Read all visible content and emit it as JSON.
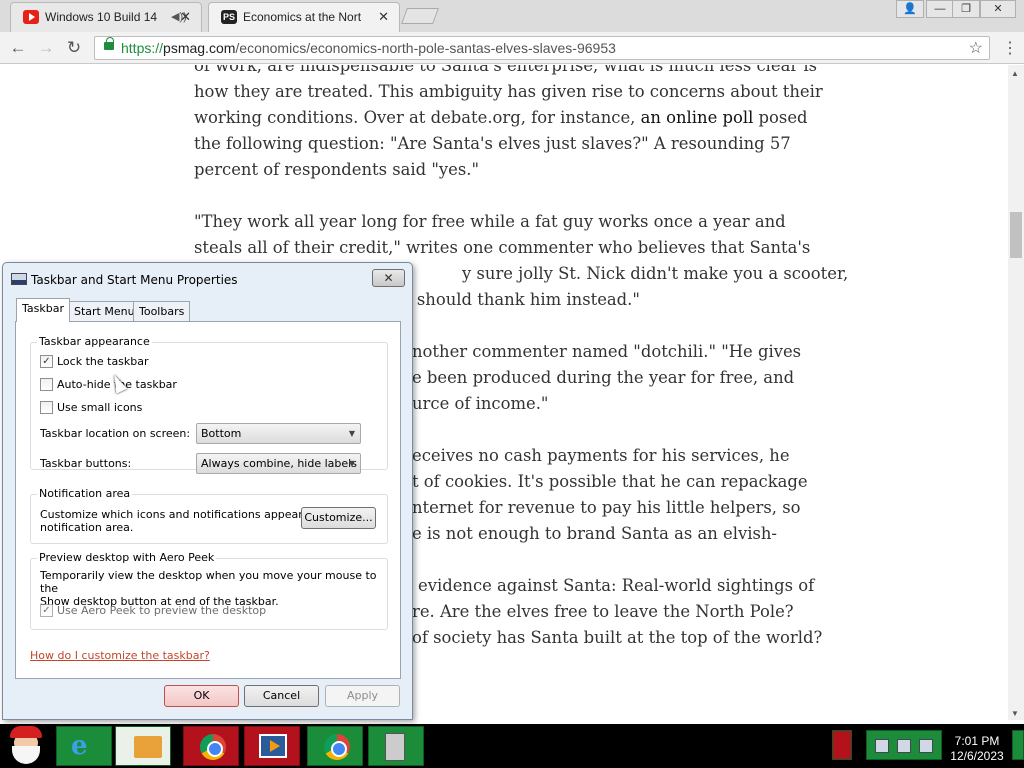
{
  "browser": {
    "tabs": [
      {
        "title": "Windows 10 Build 14",
        "favicon": "youtube-icon",
        "audio": "speaker-icon"
      },
      {
        "title": "Economics at the North P",
        "favicon": "psmag-icon"
      }
    ],
    "window_controls": {
      "user": "👤",
      "minimize": "—",
      "restore": "❐",
      "close": "✕"
    },
    "nav": {
      "back": "←",
      "forward": "→",
      "reload": "↻"
    },
    "url": {
      "scheme": "https://",
      "host": "psmag.com",
      "path": "/economics/economics-north-pole-santas-elves-slaves-96953"
    },
    "star": "☆",
    "menu": "⋮",
    "tab_close": "✕"
  },
  "article": {
    "paragraphs": [
      [
        "of work, are indispensable to Santa's enterprise, what is much less clear is",
        "how they are treated. This ambiguity has given rise to concerns about their",
        "working conditions. Over at debate.org, for instance, an online poll posed",
        "the following question: \"Are Santa's elves just slaves?\" A resounding 57",
        "percent of respondents said \"yes.\""
      ],
      [
        "\"They work all year long for free while a fat guy works once a year and",
        "steals all of their credit,\" writes one commenter who believes that Santa's",
        "y sure jolly St. Nick didn't make you a scooter,",
        "you should thank him instead.\""
      ],
      [
        "nother commenter named \"dotchili.\" \"He gives",
        "e been produced during the year for free, and",
        "urce of income.\""
      ],
      [
        "eceives no cash payments for his services, he",
        "t of cookies. It's possible that he can repackage",
        "nternet for revenue to pay his little helpers, so",
        "e is not enough to brand Santa as an elvish-"
      ],
      [
        "evidence against Santa: Real-world sightings of",
        "re. Are the elves free to leave the North Pole?",
        "of society has Santa built at the top of the world?"
      ]
    ],
    "link_text": "an online poll"
  },
  "dialog": {
    "title": "Taskbar and Start Menu Properties",
    "close": "✕",
    "tabs": [
      "Taskbar",
      "Start Menu",
      "Toolbars"
    ],
    "active_tab": "Taskbar",
    "appearance": {
      "title": "Taskbar appearance",
      "lock": {
        "label": "Lock the taskbar",
        "checked": true
      },
      "autohide": {
        "label": "Auto-hide the taskbar",
        "checked": false
      },
      "small_icons": {
        "label": "Use small icons",
        "checked": false
      },
      "location_label": "Taskbar location on screen:",
      "location_value": "Bottom",
      "buttons_label": "Taskbar buttons:",
      "buttons_value": "Always combine, hide labels"
    },
    "notification": {
      "title": "Notification area",
      "desc_1": "Customize which icons and notifications appear in the",
      "desc_2": "notification area.",
      "customize": "Customize..."
    },
    "peek": {
      "title": "Preview desktop with Aero Peek",
      "desc_1": "Temporarily view the desktop when you move your mouse to the",
      "desc_2": "Show desktop button at end of the taskbar.",
      "checkbox": {
        "label": "Use Aero Peek to preview the desktop",
        "checked": true,
        "disabled": true
      }
    },
    "help_link": "How do I customize the taskbar?",
    "ok": "OK",
    "cancel": "Cancel",
    "apply": "Apply"
  },
  "taskbar": {
    "clock_time": "7:01 PM",
    "clock_date": "12/6/2023",
    "items": [
      "santa-start-icon",
      "ie-icon",
      "folder-icon",
      "chrome-icon",
      "media-player-icon",
      "chrome-icon",
      "computer-icon"
    ]
  }
}
